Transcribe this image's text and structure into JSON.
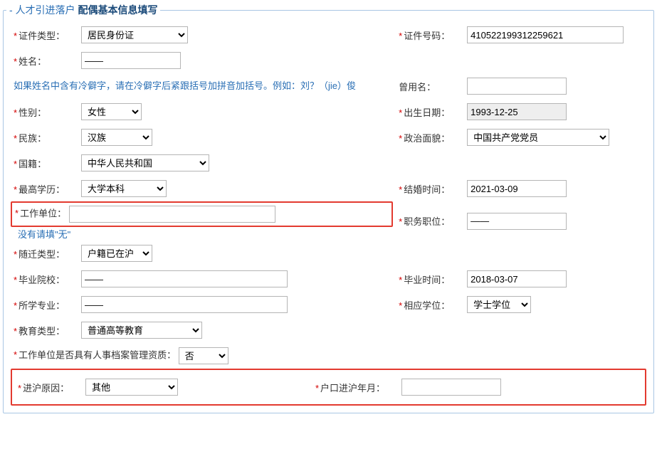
{
  "legend": {
    "dash": "-",
    "link": "人才引进落户",
    "bold": "配偶基本信息填写"
  },
  "labels": {
    "cert_type": "证件类型：",
    "cert_no": "证件号码：",
    "name": "姓名：",
    "name_hint": "如果姓名中含有冷僻字，请在冷僻字后紧跟括号加拼音加括号。例如：刘？（jie）俊",
    "former_name": "曾用名：",
    "gender": "性别：",
    "birth": "出生日期：",
    "nation": "民族：",
    "party": "政治面貌：",
    "nationality": "国籍：",
    "edu_highest": "最高学历：",
    "marry_time": "结婚时间：",
    "work_unit": "工作单位：",
    "work_unit_hint": "没有请填\"无\"",
    "position": "职务职位：",
    "migrate_type": "随迁类型：",
    "grad_school": "毕业院校：",
    "grad_time": "毕业时间：",
    "major": "所学专业：",
    "degree": "相应学位：",
    "edu_type": "教育类型：",
    "archive_qual": "工作单位是否具有人事档案管理资质：",
    "enter_reason": "进沪原因：",
    "enter_year": "户口进沪年月："
  },
  "values": {
    "cert_type": "居民身份证",
    "cert_no": "410522199312259621",
    "name": "——",
    "former_name": "",
    "gender": "女性",
    "birth": "1993-12-25",
    "nation": "汉族",
    "party": "中国共产党党员",
    "nationality": "中华人民共和国",
    "edu_highest": "大学本科",
    "marry_time": "2021-03-09",
    "work_unit": "",
    "position": "——",
    "migrate_type": "户籍已在沪",
    "grad_school": "——",
    "grad_time": "2018-03-07",
    "major": "——",
    "degree": "学士学位",
    "edu_type": "普通高等教育",
    "archive_qual": "否",
    "enter_reason": "其他",
    "enter_year": ""
  }
}
